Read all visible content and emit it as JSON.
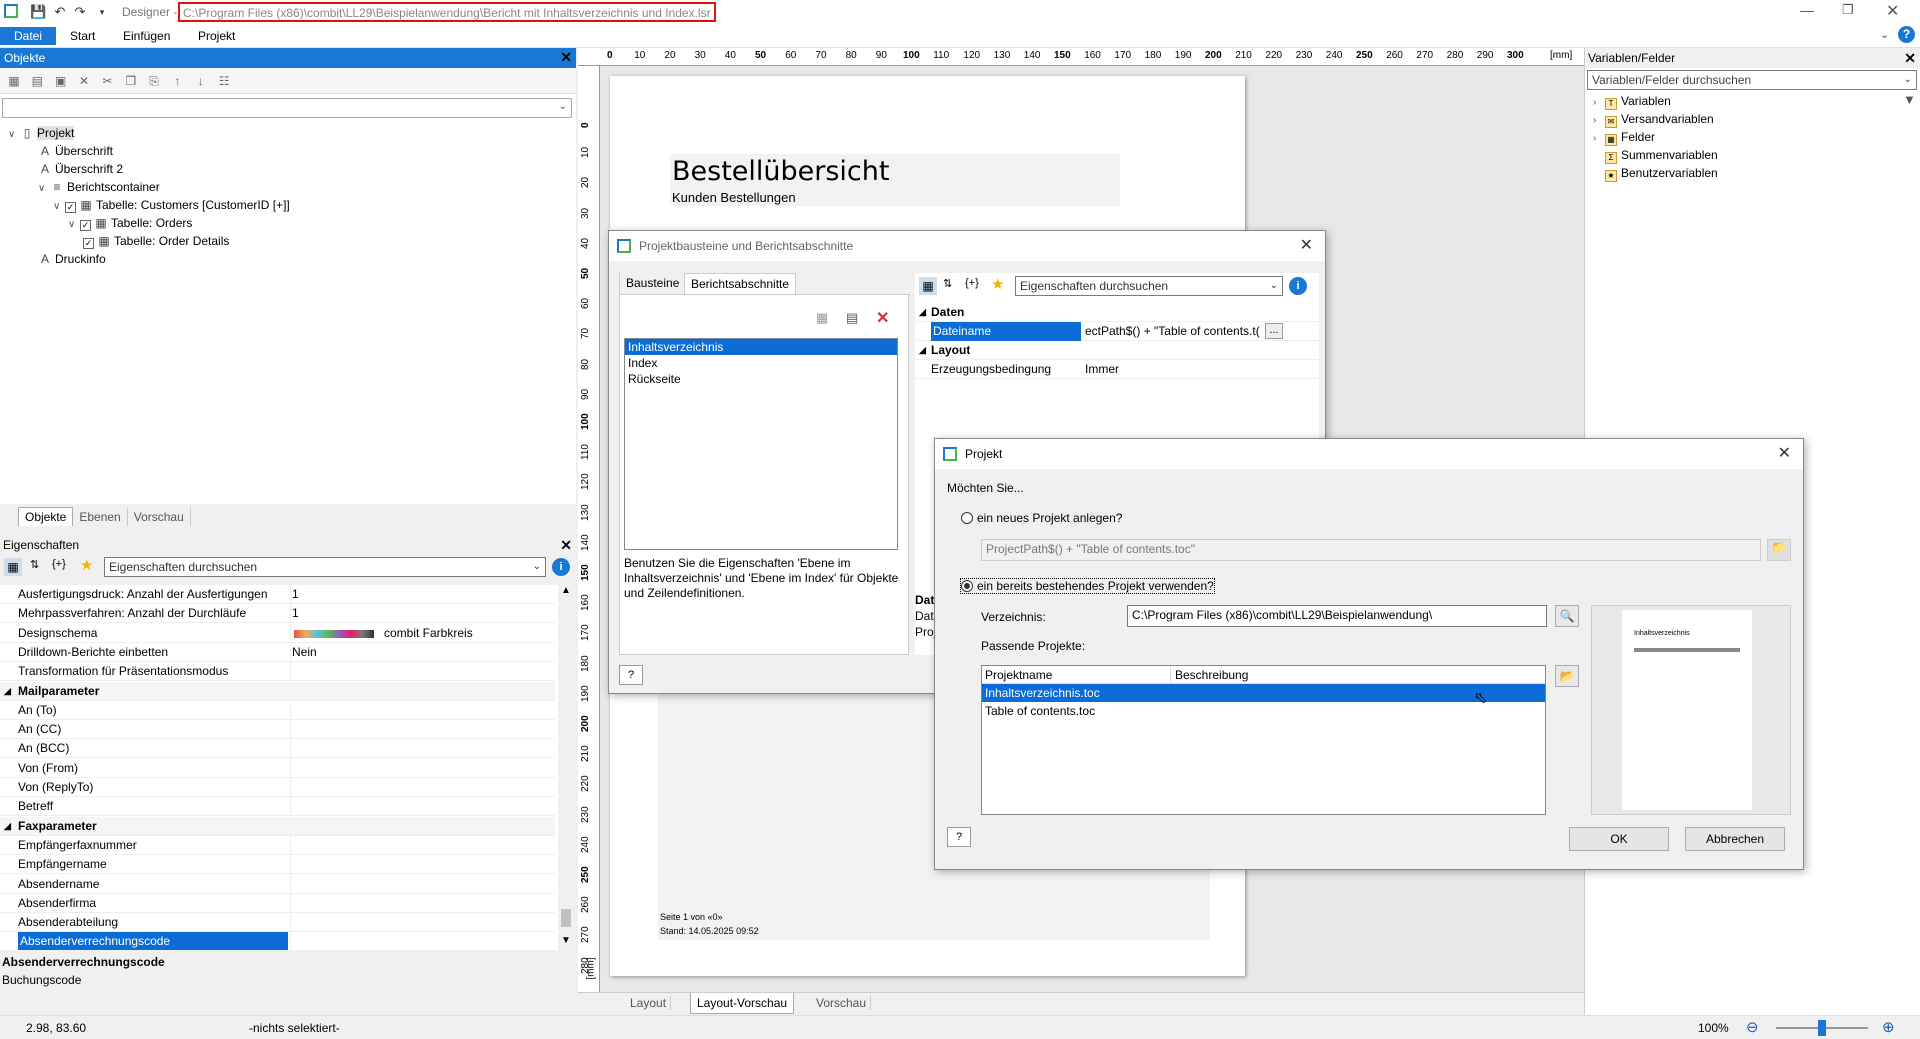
{
  "titlebar": {
    "app_name": "Designer -",
    "path": "C:\\Program Files (x86)\\combit\\LL29\\Beispielanwendung\\Bericht mit Inhaltsverzeichnis und Index.lsr"
  },
  "menu": [
    "Datei",
    "Start",
    "Einfügen",
    "Projekt"
  ],
  "objects_panel": {
    "title": "Objekte",
    "tree": [
      {
        "label": "Projekt",
        "indent": 0,
        "icon": "page"
      },
      {
        "label": "Überschrift",
        "indent": 2,
        "icon": "A"
      },
      {
        "label": "Überschrift 2",
        "indent": 2,
        "icon": "A"
      },
      {
        "label": "Berichtscontainer",
        "indent": 2,
        "icon": "list"
      },
      {
        "label": "Tabelle: Customers [CustomerID [+]]",
        "indent": 3,
        "icon": "table"
      },
      {
        "label": "Tabelle: Orders",
        "indent": 4,
        "icon": "table"
      },
      {
        "label": "Tabelle: Order Details",
        "indent": 5,
        "icon": "table"
      },
      {
        "label": "Druckinfo",
        "indent": 2,
        "icon": "A"
      }
    ],
    "tabs": [
      "Objekte",
      "Ebenen",
      "Vorschau"
    ]
  },
  "properties_panel": {
    "title": "Eigenschaften",
    "search_placeholder": "Eigenschaften durchsuchen",
    "rows": [
      {
        "name": "Ausfertigungsdruck: Anzahl der Ausfertigungen",
        "value": "1"
      },
      {
        "name": "Mehrpassverfahren: Anzahl der Durchläufe",
        "value": "1"
      },
      {
        "name": "Designschema",
        "value": "combit Farbkreis"
      },
      {
        "name": "Drilldown-Berichte einbetten",
        "value": "Nein"
      },
      {
        "name": "Transformation für Präsentationsmodus",
        "value": ""
      },
      {
        "name": "Mailparameter",
        "value": "",
        "section": true
      },
      {
        "name": "An (To)",
        "value": ""
      },
      {
        "name": "An (CC)",
        "value": ""
      },
      {
        "name": "An (BCC)",
        "value": ""
      },
      {
        "name": "Von (From)",
        "value": ""
      },
      {
        "name": "Von (ReplyTo)",
        "value": ""
      },
      {
        "name": "Betreff",
        "value": ""
      },
      {
        "name": "Faxparameter",
        "value": "",
        "section": true
      },
      {
        "name": "Empfängerfaxnummer",
        "value": ""
      },
      {
        "name": "Empfängername",
        "value": ""
      },
      {
        "name": "Absendername",
        "value": ""
      },
      {
        "name": "Absenderfirma",
        "value": ""
      },
      {
        "name": "Absenderabteilung",
        "value": ""
      },
      {
        "name": "Absenderverrechnungscode",
        "value": "",
        "selected": true
      }
    ],
    "desc_title": "Absenderverrechnungscode",
    "desc_text": "Buchungscode"
  },
  "ruler": {
    "unit": "[mm]",
    "h_ticks": [
      "0",
      "10",
      "20",
      "30",
      "40",
      "50",
      "60",
      "70",
      "80",
      "90",
      "100",
      "110",
      "120",
      "130",
      "140",
      "150",
      "160",
      "170",
      "180",
      "190",
      "200",
      "210",
      "220",
      "230",
      "240",
      "250",
      "260",
      "270",
      "280",
      "290",
      "300"
    ],
    "v_ticks": [
      "0",
      "10",
      "20",
      "30",
      "40",
      "50",
      "60",
      "70",
      "80",
      "90",
      "100",
      "110",
      "120",
      "130",
      "140",
      "150",
      "160",
      "170",
      "180",
      "190",
      "200",
      "210",
      "220",
      "230",
      "240",
      "250",
      "260",
      "270",
      "280"
    ]
  },
  "page": {
    "title": "Bestellübersicht",
    "subtitle": "Kunden Bestellungen",
    "footer_page": "Seite 1 von «0»",
    "footer_date": "Stand: 14.05.2025 09:52"
  },
  "bottom_tabs": [
    "Layout",
    "Layout-Vorschau",
    "Vorschau"
  ],
  "variables_panel": {
    "title": "Variablen/Felder",
    "search_placeholder": "Variablen/Felder durchsuchen",
    "items": [
      "Variablen",
      "Versandvariablen",
      "Felder",
      "Summenvariablen",
      "Benutzervariablen"
    ]
  },
  "sections_dialog": {
    "title": "Projektbausteine und Berichtsabschnitte",
    "tabs": [
      "Bausteine",
      "Berichtsabschnitte"
    ],
    "list": [
      "Inhaltsverzeichnis",
      "Index",
      "Rückseite"
    ],
    "hint": "Benutzen Sie die Eigenschaften 'Ebene im Inhaltsverzeichnis' und 'Ebene im Index' für Objekte und Zeilendefinitionen.",
    "search_placeholder": "Eigenschaften durchsuchen",
    "props": [
      {
        "name": "Daten",
        "value": "",
        "section": true
      },
      {
        "name": "Dateiname",
        "value": "ectPath$() + \"Table of contents.t(",
        "selected": true
      },
      {
        "name": "Layout",
        "value": "",
        "section": true
      },
      {
        "name": "Erzeugungsbedingung",
        "value": "Immer"
      }
    ],
    "bottom_fragments": [
      "Dat",
      "Date",
      "Proj"
    ]
  },
  "project_dialog": {
    "title": "Projekt",
    "question": "Möchten Sie...",
    "option_new": "ein neues Projekt anlegen?",
    "new_path": "ProjectPath$() + \"Table of contents.toc\"",
    "option_existing": "ein bereits bestehendes Projekt verwenden?",
    "dir_label": "Verzeichnis:",
    "dir_value": "C:\\Program Files (x86)\\combit\\LL29\\Beispielanwendung\\",
    "matching_label": "Passende Projekte:",
    "col_name": "Projektname",
    "col_desc": "Beschreibung",
    "projects": [
      "Inhaltsverzeichnis.toc",
      "Table of contents.toc"
    ],
    "preview_heading": "Inhaltsverzeichnis",
    "ok": "OK",
    "cancel": "Abbrechen"
  },
  "status": {
    "coords": "2.98, 83.60",
    "selection": "-nichts selektiert-",
    "zoom": "100%"
  }
}
